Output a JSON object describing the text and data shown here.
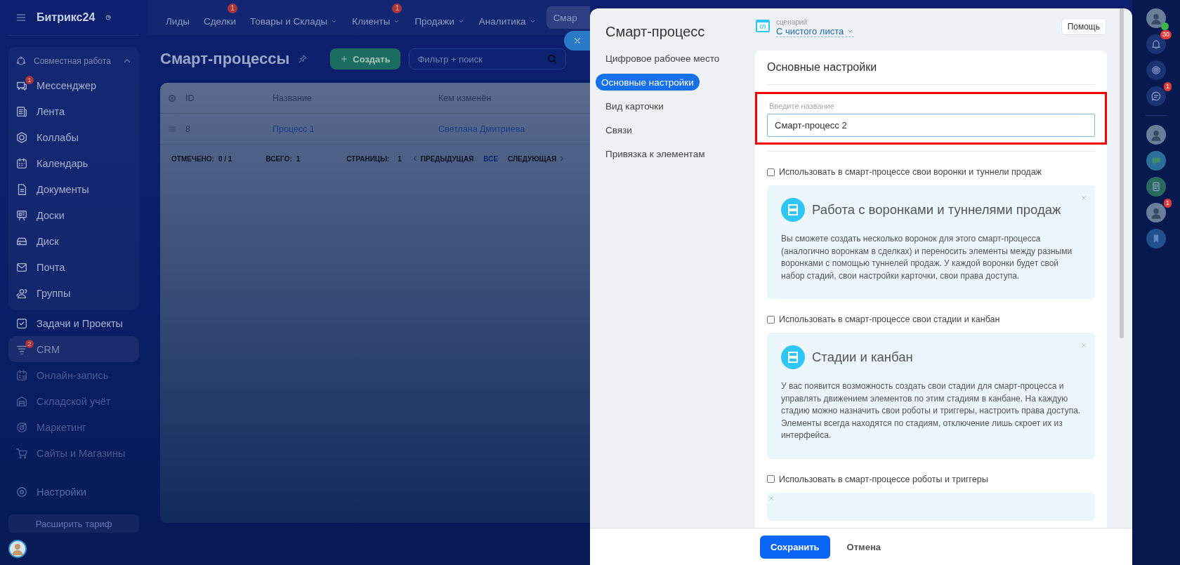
{
  "logo": {
    "text": "Битрикс24"
  },
  "top_nav": [
    {
      "label": "Лиды",
      "dropdown": false,
      "selected": false
    },
    {
      "label": "Сделки",
      "dropdown": false,
      "badge": "1",
      "selected": false
    },
    {
      "label": "Товары и Склады",
      "dropdown": true,
      "selected": false
    },
    {
      "label": "Клиенты",
      "dropdown": true,
      "badge": "1",
      "selected": false
    },
    {
      "label": "Продажи",
      "dropdown": true,
      "selected": false
    },
    {
      "label": "Аналитика",
      "dropdown": true,
      "selected": false
    },
    {
      "label": "Смар",
      "dropdown": false,
      "selected": true
    }
  ],
  "sidebar": {
    "group": {
      "title": "Совместная работа",
      "expanded": true,
      "items": [
        {
          "label": "Мессенджер",
          "badge": "1",
          "selected": false
        },
        {
          "label": "Лента",
          "selected": false
        },
        {
          "label": "Коллабы",
          "selected": false
        },
        {
          "label": "Календарь",
          "selected": false
        },
        {
          "label": "Документы",
          "selected": false
        },
        {
          "label": "Доски",
          "selected": false
        },
        {
          "label": "Диск",
          "selected": false
        },
        {
          "label": "Почта",
          "selected": false
        },
        {
          "label": "Группы",
          "selected": false
        }
      ]
    },
    "items": [
      {
        "label": "Задачи и Проекты",
        "selected": false
      },
      {
        "label": "CRM",
        "badge": "2",
        "selected": true
      },
      {
        "label": "Онлайн-запись",
        "selected": false
      },
      {
        "label": "Складской учёт",
        "selected": false
      },
      {
        "label": "Маркетинг",
        "selected": false
      },
      {
        "label": "Сайты и Магазины",
        "selected": false
      }
    ],
    "settings": "Настройки",
    "upgrade_button": "Расширить тариф"
  },
  "page": {
    "title": "Смарт-процессы",
    "create_button": "Создать",
    "filter": {
      "placeholder": "Фильтр + поиск"
    }
  },
  "table": {
    "columns": [
      "ID",
      "Название",
      "Кем изменён"
    ],
    "rows": [
      {
        "id": "8",
        "name": "Процесс 1",
        "modified_by": "Светлана Дмитриева"
      }
    ],
    "footer": {
      "checked_label": "ОТМЕЧЕНО:",
      "checked": "0 / 1",
      "total_label": "ВСЕГО:",
      "total": "1",
      "pages_label": "СТРАНИЦЫ:",
      "page": "1",
      "prev": "ПРЕДЫДУЩАЯ",
      "all": "ВСЕ",
      "next": "СЛЕДУЮЩАЯ"
    }
  },
  "right_rail": [
    {
      "kind": "presence"
    },
    {
      "kind": "bell",
      "badge": "30"
    },
    {
      "kind": "spiral"
    },
    {
      "kind": "chat",
      "badge": "1"
    },
    {
      "kind": "divider"
    },
    {
      "kind": "avatar"
    },
    {
      "kind": "message"
    },
    {
      "kind": "document"
    },
    {
      "kind": "avatar",
      "badge": "1"
    },
    {
      "kind": "bookmark"
    }
  ],
  "panel": {
    "title": "Смарт-процесс",
    "nav": [
      {
        "label": "Цифровое рабочее место",
        "selected": false
      },
      {
        "label": "Основные настройки",
        "selected": true
      },
      {
        "label": "Вид карточки",
        "selected": false
      },
      {
        "label": "Связи",
        "selected": false
      },
      {
        "label": "Привязка к элементам",
        "selected": false
      }
    ],
    "scenario": {
      "caption": "сценарий",
      "value": "С чистого листа"
    },
    "help_button": "Помощь",
    "section_title": "Основные настройки",
    "name_field": {
      "label": "Введите название",
      "value": "Смарт-процесс 2",
      "highlighted": true
    },
    "options": [
      {
        "label": "Использовать в смарт-процессе свои воронки и туннели продаж",
        "checked": false,
        "info": {
          "title": "Работа с воронками и туннелями продаж",
          "text": "Вы сможете создать несколько воронок для этого смарт-процесса (аналогично воронкам в сделках) и переносить элементы между разными воронками с помощью туннелей продаж. У каждой воронки будет свой набор стадий, свои настройки карточки, свои права доступа."
        }
      },
      {
        "label": "Использовать в смарт-процессе свои стадии и канбан",
        "checked": false,
        "info": {
          "title": "Стадии и канбан",
          "text": "У вас появится возможность создать свои стадии для смарт-процесса и управлять движением элементов по этим стадиям в канбане. На каждую стадию можно назначить свои роботы и триггеры, настроить права доступа. Элементы всегда находятся по стадиям, отключение лишь скроет их из интерфейса."
        }
      },
      {
        "label": "Использовать в смарт-процессе роботы и триггеры",
        "checked": false,
        "info": {
          "partial": true
        }
      }
    ],
    "save_button": "Сохранить",
    "cancel_button": "Отмена"
  }
}
